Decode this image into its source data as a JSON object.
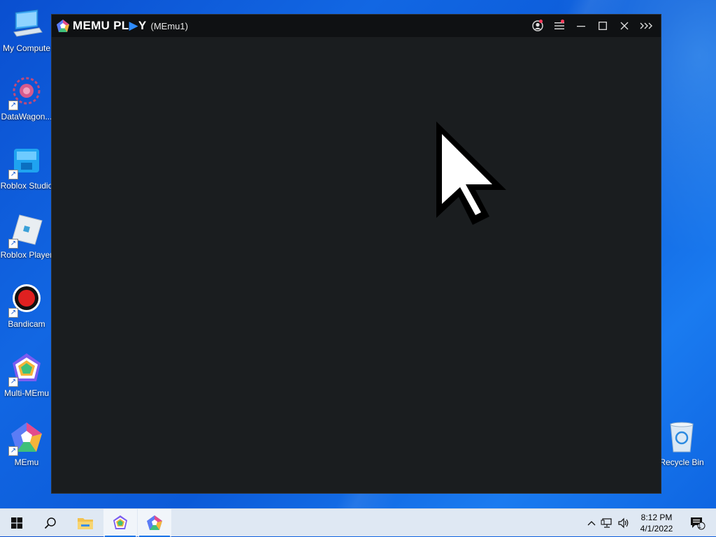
{
  "desktop": {
    "icons": [
      {
        "label": "My Compute",
        "icon": "computer-icon"
      },
      {
        "label": "DataWagon...",
        "icon": "datawagon-icon"
      },
      {
        "label": "Roblox Studio",
        "icon": "roblox-studio-icon"
      },
      {
        "label": "Roblox Player",
        "icon": "roblox-player-icon"
      },
      {
        "label": "Bandicam",
        "icon": "bandicam-icon"
      },
      {
        "label": "Multi-MEmu",
        "icon": "multi-memu-icon"
      },
      {
        "label": "MEmu",
        "icon": "memu-icon"
      }
    ],
    "recycle_bin": {
      "label": "Recycle Bin",
      "icon": "recycle-bin-icon"
    }
  },
  "window": {
    "brand_main": "MEMU PL",
    "brand_accent": "▶",
    "brand_end": "Y",
    "instance": "(MEmu1)",
    "colors": {
      "titlebar": "#0f1113",
      "content": "#1a1d1f",
      "notify_dot": "#ff3b5c",
      "brand_accent": "#2f8cff"
    }
  },
  "taskbar": {
    "items": [
      "windows-start-icon",
      "search-icon",
      "file-explorer-icon",
      "multi-memu-icon",
      "memu-icon"
    ],
    "clock_time": "8:12 PM",
    "clock_date": "4/1/2022",
    "notification_count": "1"
  }
}
